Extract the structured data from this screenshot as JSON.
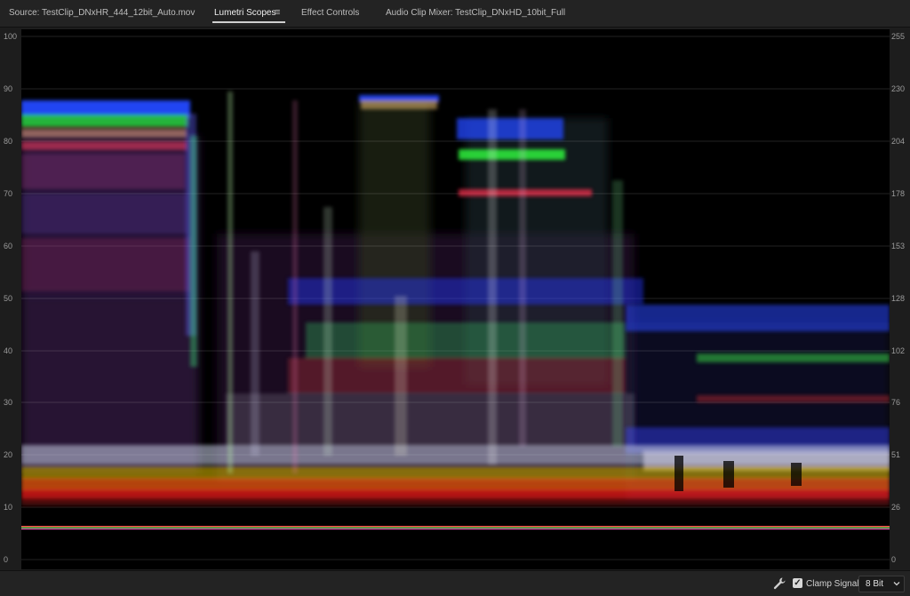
{
  "tabs": [
    {
      "label": "Source: TestClip_DNxHR_444_12bit_Auto.mov",
      "active": false
    },
    {
      "label": "Lumetri Scopes",
      "active": true
    },
    {
      "label": "Effect Controls",
      "active": false
    },
    {
      "label": "Audio Clip Mixer: TestClip_DNxHD_10bit_Full",
      "active": false
    }
  ],
  "panel_menu_icon": "hamburger-icon",
  "scale_left": [
    "100",
    "90",
    "80",
    "70",
    "60",
    "50",
    "40",
    "30",
    "20",
    "10",
    "0"
  ],
  "scale_right": [
    "255",
    "230",
    "204",
    "178",
    "153",
    "128",
    "102",
    "76",
    "51",
    "26",
    "0"
  ],
  "bottom": {
    "settings_icon": "wrench-icon",
    "clamp_signal": {
      "label": "Clamp Signal",
      "checked": true
    },
    "bit_depth": {
      "selected": "8 Bit"
    }
  },
  "colors": {
    "red": "#ff3030",
    "green": "#30ff40",
    "blue": "#2848ff"
  }
}
